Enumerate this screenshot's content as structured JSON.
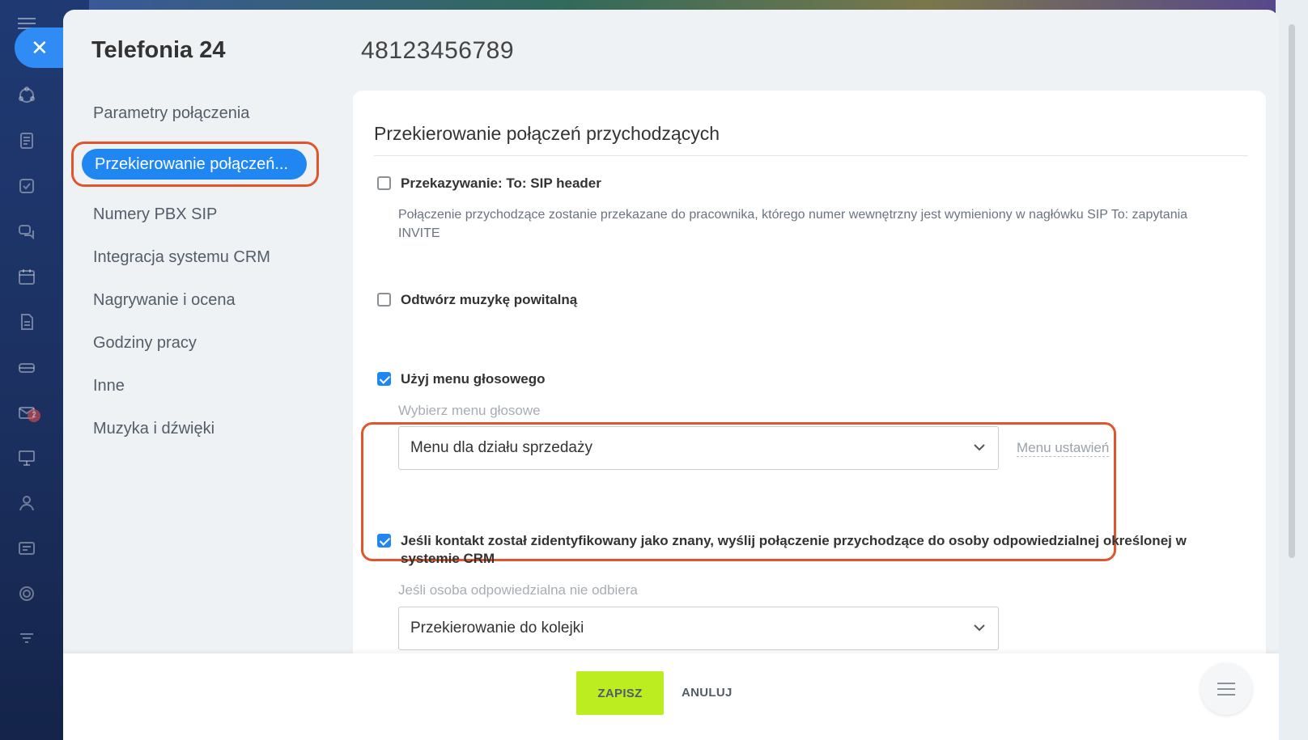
{
  "app": {
    "title": "Telefonia 24",
    "number": "48123456789"
  },
  "sidebar": {
    "items": [
      {
        "label": "Parametry połączenia"
      },
      {
        "label": "Przekierowanie połączeń..."
      },
      {
        "label": "Numery PBX SIP"
      },
      {
        "label": "Integracja systemu CRM"
      },
      {
        "label": "Nagrywanie i ocena"
      },
      {
        "label": "Godziny pracy"
      },
      {
        "label": "Inne"
      },
      {
        "label": "Muzyka i dźwięki"
      }
    ],
    "active_index": 1
  },
  "rail": {
    "badge_count": "2",
    "icons": [
      "close-icon",
      "activity-icon",
      "feed-icon",
      "tasks-icon",
      "chat-icon",
      "calendar-icon",
      "document-icon",
      "drive-icon",
      "mail-icon",
      "presentation-icon",
      "contacts-icon",
      "card-icon",
      "target-icon",
      "filter-icon"
    ]
  },
  "section": {
    "title": "Przekierowanie połączeń przychodzących",
    "sip_forward": {
      "label": "Przekazywanie: To: SIP header",
      "checked": false,
      "description": "Połączenie przychodzące zostanie przekazane do pracownika, którego numer wewnętrzny jest wymieniony w nagłówku SIP To: zapytania INVITE"
    },
    "welcome_music": {
      "label": "Odtwórz muzykę powitalną",
      "checked": false
    },
    "voice_menu": {
      "label": "Użyj menu głosowego",
      "checked": true,
      "hint": "Wybierz menu głosowe",
      "selected": "Menu dla działu sprzedaży",
      "settings_link": "Menu ustawień"
    },
    "crm_forward": {
      "label": "Jeśli kontakt został zidentyfikowany jako znany, wyślij połączenie przychodzące do osoby odpowiedzialnej określonej w systemie CRM",
      "checked": true,
      "hint": "Jeśli osoba odpowiedzialna nie odbiera",
      "selected": "Przekierowanie do kolejki"
    }
  },
  "footer": {
    "save_label": "ZAPISZ",
    "cancel_label": "ANULUJ"
  },
  "colors": {
    "accent": "#1f86f2",
    "save": "#bbed21",
    "highlight": "#e1552d"
  }
}
